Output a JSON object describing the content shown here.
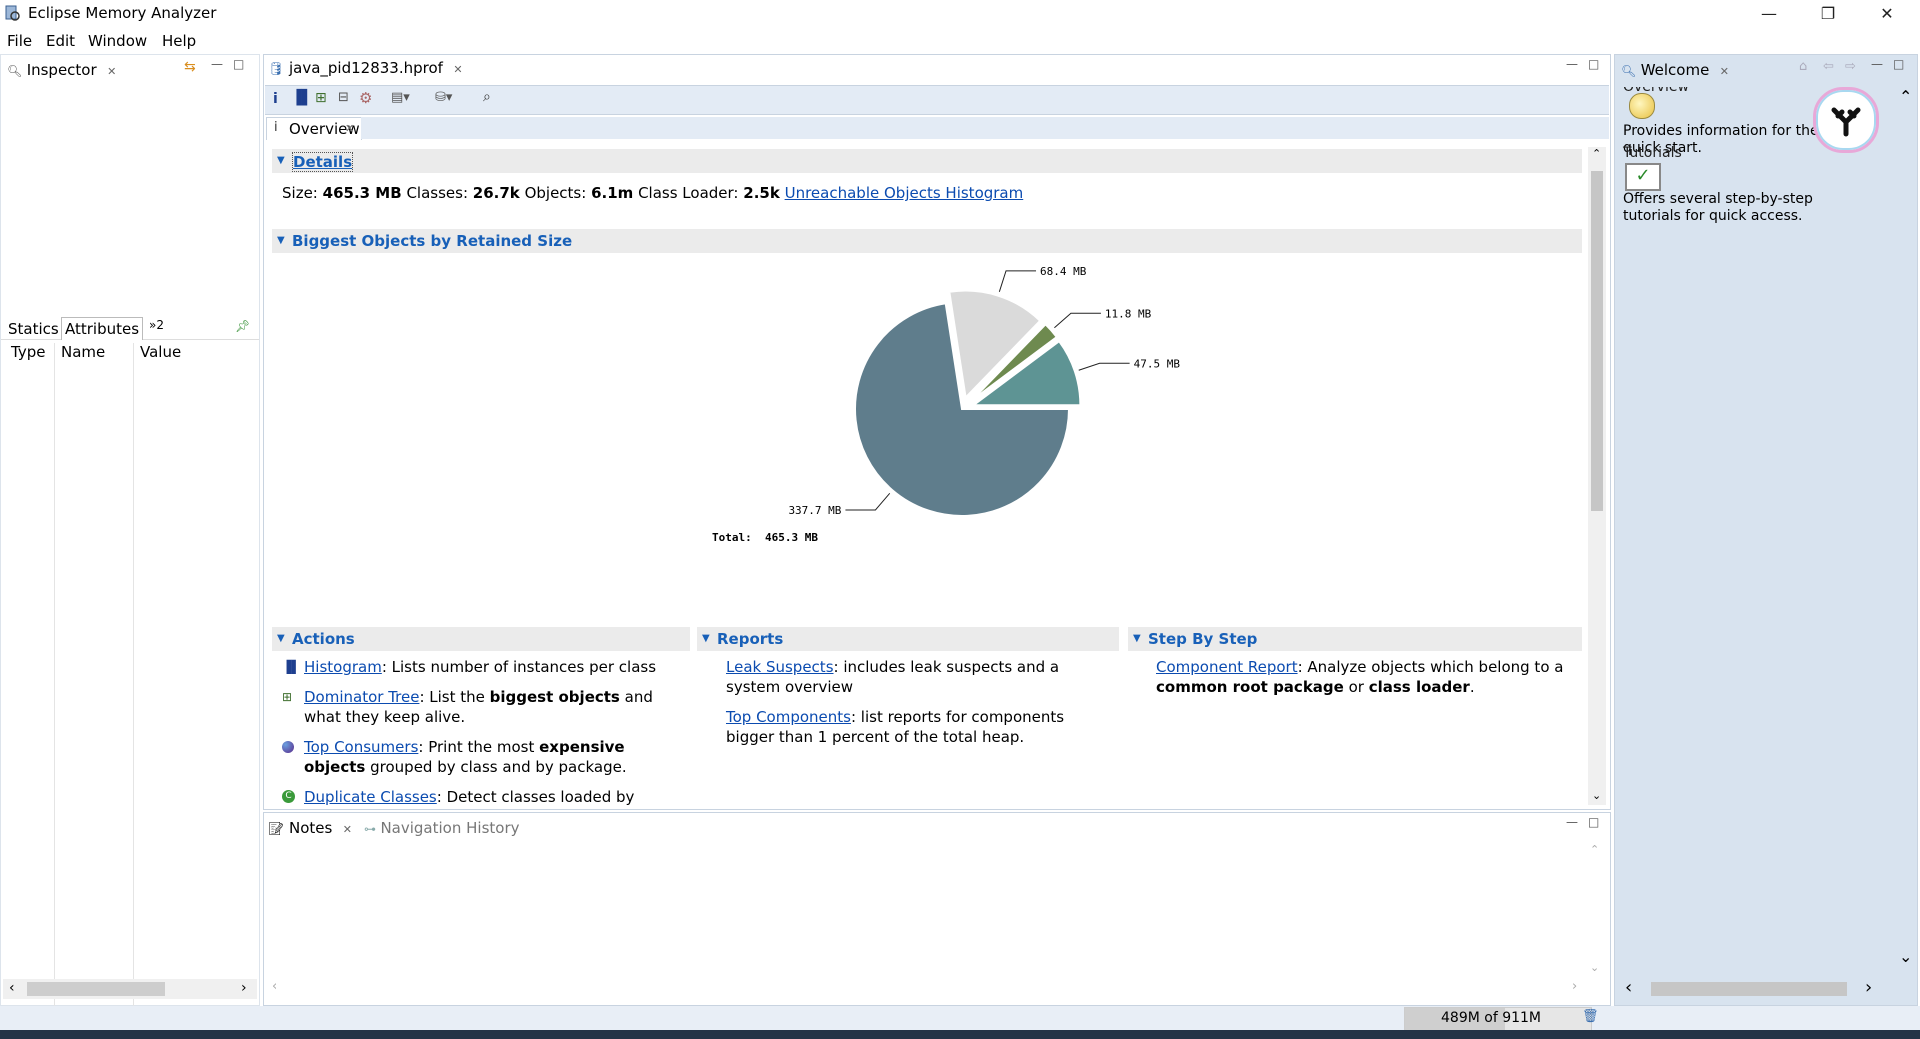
{
  "app": {
    "title": "Eclipse Memory Analyzer",
    "window_controls": [
      "—",
      "❐",
      "✕"
    ]
  },
  "menu": {
    "file": "File",
    "edit": "Edit",
    "window": "Window",
    "help": "Help"
  },
  "inspector": {
    "tab_label": "Inspector",
    "subtabs": {
      "statics": "Statics",
      "attributes": "Attributes",
      "more": "»2"
    },
    "columns": {
      "type": "Type",
      "name": "Name",
      "value": "Value"
    }
  },
  "editor": {
    "tab_label": "java_pid12833.hprof",
    "subtab_label": "Overview",
    "details": {
      "header": "Details",
      "size_label": "Size:",
      "size_value": "465.3 MB",
      "classes_label": "Classes:",
      "classes_value": "26.7k",
      "objects_label": "Objects:",
      "objects_value": "6.1m",
      "loader_label": "Class Loader:",
      "loader_value": "2.5k",
      "unreachable_link": "Unreachable Objects Histogram"
    },
    "biggest": {
      "header": "Biggest Objects by Retained Size",
      "labels": [
        "337.7 MB",
        "68.4 MB",
        "11.8 MB",
        "47.5 MB"
      ],
      "total": "Total:  465.3 MB"
    },
    "actions": {
      "header": "Actions",
      "items": [
        {
          "link": "Histogram",
          "text": ": Lists number of instances per class"
        },
        {
          "link": "Dominator Tree",
          "text_pre": ": List the ",
          "bold": "biggest objects",
          "text_post": " and what they keep alive."
        },
        {
          "link": "Top Consumers",
          "text_pre": ": Print the most ",
          "bold": "expensive objects",
          "text_post": " grouped by class and by package."
        },
        {
          "link": "Duplicate Classes",
          "text": ": Detect classes loaded by"
        }
      ]
    },
    "reports": {
      "header": "Reports",
      "items": [
        {
          "link": "Leak Suspects",
          "text": ": includes leak suspects and a system overview"
        },
        {
          "link": "Top Components",
          "text": ": list reports for components bigger than 1 percent of the total heap."
        }
      ]
    },
    "stepbystep": {
      "header": "Step By Step",
      "link": "Component Report",
      "text_pre": ": Analyze objects which belong to a ",
      "bold1": "common root package",
      "mid": " or ",
      "bold2": "class loader",
      "end": "."
    }
  },
  "bottom": {
    "notes_tab": "Notes",
    "history_tab": "Navigation History"
  },
  "welcome": {
    "tab_label": "Welcome",
    "overview_title": "Overview",
    "overview_desc": "Provides information for the quick start.",
    "tutorials_title": "Tutorials",
    "tutorials_desc": "Offers several step-by-step tutorials for quick access."
  },
  "status": {
    "heap": "489M of 911M",
    "heap_used_fraction": 0.537
  },
  "chart_data": {
    "type": "pie",
    "title": "",
    "values": [
      337.7,
      68.4,
      11.8,
      47.5
    ],
    "labels": [
      "337.7 MB",
      "68.4 MB",
      "11.8 MB",
      "47.5 MB"
    ],
    "total_label": "Total:  465.3 MB",
    "colors": [
      "#5f7d8c",
      "#dadada",
      "#6e8a4f",
      "#5e9494"
    ]
  }
}
